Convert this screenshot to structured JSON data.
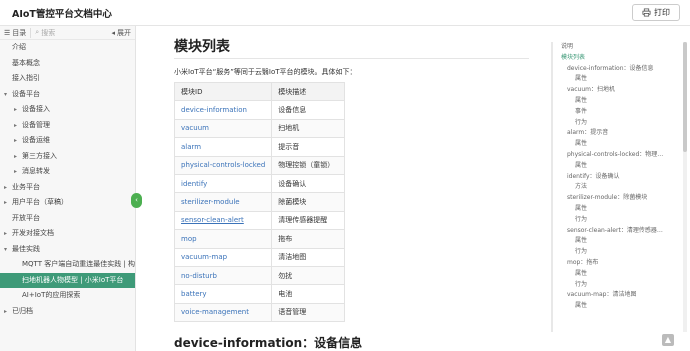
{
  "header": {
    "title": "AIoT管控平台文档中心",
    "print_label": "打印"
  },
  "sidebar": {
    "toc_label": "目录",
    "search_placeholder": "搜索",
    "expand_label": "展开",
    "items": [
      {
        "label": "介绍",
        "level": 0,
        "arrow": ""
      },
      {
        "label": "基本概念",
        "level": 0,
        "arrow": ""
      },
      {
        "label": "接入指引",
        "level": 0,
        "arrow": ""
      },
      {
        "label": "设备平台",
        "level": 0,
        "arrow": "▾"
      },
      {
        "label": "设备接入",
        "level": 1,
        "arrow": "▸"
      },
      {
        "label": "设备管理",
        "level": 1,
        "arrow": "▸"
      },
      {
        "label": "设备运维",
        "level": 1,
        "arrow": "▸"
      },
      {
        "label": "第三方接入",
        "level": 1,
        "arrow": "▸"
      },
      {
        "label": "消息转发",
        "level": 1,
        "arrow": "▸"
      },
      {
        "label": "业务平台",
        "level": 0,
        "arrow": "▸"
      },
      {
        "label": "用户平台（草稿）",
        "level": 0,
        "arrow": "▸"
      },
      {
        "label": "开放平台",
        "level": 0,
        "arrow": ""
      },
      {
        "label": "开发对接文档",
        "level": 0,
        "arrow": "▸"
      },
      {
        "label": "最佳实践",
        "level": 0,
        "arrow": "▾"
      },
      {
        "label": "MQTT 客户端自动重连最佳实践 | 构建",
        "level": 2,
        "arrow": ""
      },
      {
        "label": "扫地机器人物模型 | 小米IoT平台",
        "level": 2,
        "arrow": "",
        "active": true
      },
      {
        "label": "AI+IoT的应用探索",
        "level": 2,
        "arrow": ""
      },
      {
        "label": "已归档",
        "level": 0,
        "arrow": "▸"
      }
    ]
  },
  "main": {
    "title": "模块列表",
    "intro": "小米IoT平台“服务”等同于云翳IoT平台的模块。具体如下：",
    "table": {
      "headers": [
        "模块ID",
        "模块描述"
      ],
      "rows": [
        [
          "device-information",
          "设备信息"
        ],
        [
          "vacuum",
          "扫地机"
        ],
        [
          "alarm",
          "提示音"
        ],
        [
          "physical-controls-locked",
          "物理控锁（童锁）"
        ],
        [
          "identify",
          "设备确认"
        ],
        [
          "sterilizer-module",
          "除菌模块"
        ],
        [
          "sensor-clean-alert",
          "清理传感器提醒"
        ],
        [
          "mop",
          "拖布"
        ],
        [
          "vacuum-map",
          "清洁地图"
        ],
        [
          "no-disturb",
          "勿扰"
        ],
        [
          "battery",
          "电池"
        ],
        [
          "voice-management",
          "语音管理"
        ]
      ]
    },
    "section_title": "device-information：设备信息"
  },
  "toc": {
    "items": [
      {
        "label": "说明",
        "level": 0
      },
      {
        "label": "模块列表",
        "level": 0,
        "active": true
      },
      {
        "label": "device-information：设备信息",
        "level": 1
      },
      {
        "label": "属性",
        "level": 2
      },
      {
        "label": "vacuum：扫地机",
        "level": 1
      },
      {
        "label": "属性",
        "level": 2
      },
      {
        "label": "事件",
        "level": 2
      },
      {
        "label": "行为",
        "level": 2
      },
      {
        "label": "alarm：提示音",
        "level": 1
      },
      {
        "label": "属性",
        "level": 2
      },
      {
        "label": "physical-controls-locked：物理…",
        "level": 1
      },
      {
        "label": "属性",
        "level": 2
      },
      {
        "label": "identify：设备确认",
        "level": 1
      },
      {
        "label": "方法",
        "level": 2
      },
      {
        "label": "sterilizer-module：除菌模块",
        "level": 1
      },
      {
        "label": "属性",
        "level": 2
      },
      {
        "label": "行为",
        "level": 2
      },
      {
        "label": "sensor-clean-alert：清理传感器…",
        "level": 1
      },
      {
        "label": "属性",
        "level": 2
      },
      {
        "label": "行为",
        "level": 2
      },
      {
        "label": "mop：拖布",
        "level": 1
      },
      {
        "label": "属性",
        "level": 2
      },
      {
        "label": "行为",
        "level": 2
      },
      {
        "label": "vacuum-map：清洁地图",
        "level": 1
      },
      {
        "label": "属性",
        "level": 2
      }
    ]
  },
  "colors": {
    "accent": "#3e9a78",
    "link": "#3b73b9"
  }
}
